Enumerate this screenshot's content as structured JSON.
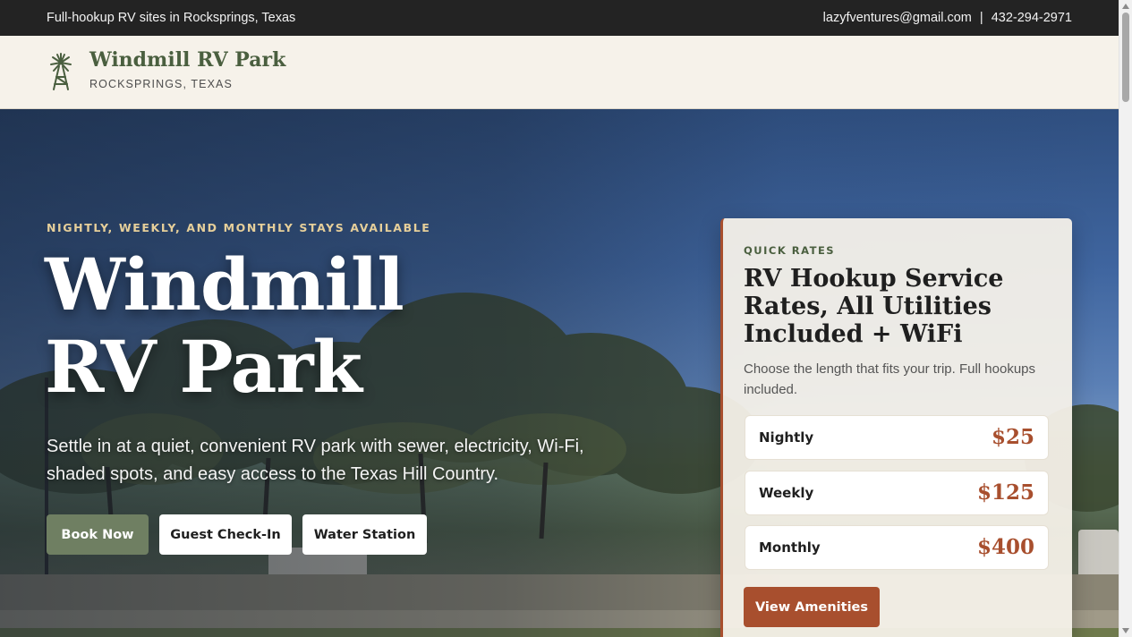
{
  "topbar": {
    "tagline": "Full-hookup RV sites in Rocksprings, Texas",
    "email": "lazyfventures@gmail.com",
    "separator": "|",
    "phone": "432-294-2971"
  },
  "header": {
    "logo_icon": "windmill-icon",
    "brand_name": "Windmill RV Park",
    "brand_sub": "ROCKSPRINGS, TEXAS"
  },
  "hero": {
    "eyebrow": "NIGHTLY, WEEKLY, AND MONTHLY STAYS AVAILABLE",
    "title_line1": "Windmill",
    "title_line2": "RV Park",
    "lead": "Settle in at a quiet, convenient RV park with sewer, electricity, Wi-Fi, shaded spots, and easy access to the Texas Hill Country.",
    "buttons": {
      "book": "Book Now",
      "checkin": "Guest Check-In",
      "water": "Water Station"
    }
  },
  "rates_card": {
    "eyebrow": "QUICK RATES",
    "title": "RV Hookup Service Rates, All Utilities Included + WiFi",
    "description": "Choose the length that fits your trip. Full hookups included.",
    "rates": [
      {
        "label": "Nightly",
        "price": "$25"
      },
      {
        "label": "Weekly",
        "price": "$125"
      },
      {
        "label": "Monthly",
        "price": "$400"
      }
    ],
    "cta": "View Amenities"
  },
  "colors": {
    "accent_green": "#6f7f62",
    "accent_rust": "#a84f2e",
    "brand_green": "#4a5f3f",
    "topbar_bg": "#232323"
  }
}
